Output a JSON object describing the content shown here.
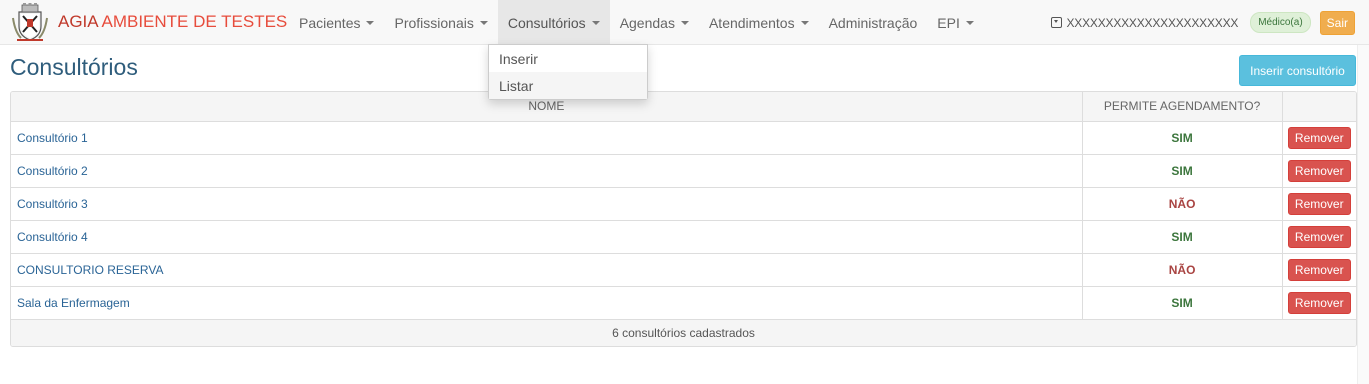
{
  "brand": {
    "part1": "AGIA",
    "part2": "AMBIENTE DE TESTES",
    "logo": "coat-of-arms-logo"
  },
  "nav": [
    {
      "label": "Pacientes",
      "caret": true
    },
    {
      "label": "Profissionais",
      "caret": true
    },
    {
      "label": "Consultórios",
      "caret": true,
      "active": true
    },
    {
      "label": "Agendas",
      "caret": true
    },
    {
      "label": "Atendimentos",
      "caret": true
    },
    {
      "label": "Administração",
      "caret": false
    },
    {
      "label": "EPI",
      "caret": true
    }
  ],
  "user": {
    "name": "XXXXXXXXXXXXXXXXXXXXXX",
    "role": "Médico(a)",
    "logout": "Sair"
  },
  "dropdown": {
    "items": [
      "Inserir",
      "Listar"
    ]
  },
  "page": {
    "title": "Consultórios",
    "insert_button": "Inserir consultório"
  },
  "table": {
    "headers": [
      "NOME",
      "PERMITE AGENDAMENTO?",
      ""
    ],
    "rows": [
      {
        "name": "Consultório 1",
        "agendamento": "SIM",
        "action": "Remover"
      },
      {
        "name": "Consultório 2",
        "agendamento": "SIM",
        "action": "Remover"
      },
      {
        "name": "Consultório 3",
        "agendamento": "NÃO",
        "action": "Remover"
      },
      {
        "name": "Consultório 4",
        "agendamento": "SIM",
        "action": "Remover"
      },
      {
        "name": "CONSULTORIO RESERVA",
        "agendamento": "NÃO",
        "action": "Remover"
      },
      {
        "name": "Sala da Enfermagem",
        "agendamento": "SIM",
        "action": "Remover"
      }
    ],
    "footer": "6 consultórios cadastrados"
  },
  "colors": {
    "title": "#2f5d7c",
    "link": "#2a6496",
    "sim": "#3c763d",
    "nao": "#a94442",
    "remove": "#d9534f",
    "info": "#5bc0de",
    "warning": "#f0ad4e"
  }
}
